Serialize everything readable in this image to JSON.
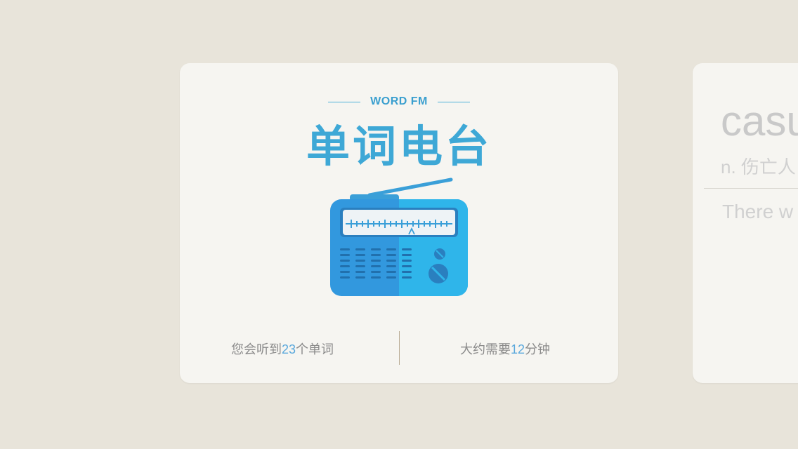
{
  "main_card": {
    "subtitle": "WORD FM",
    "title": "单词电台",
    "stats": {
      "words_prefix": "您会听到",
      "words_count": "23",
      "words_suffix": "个单词",
      "time_prefix": "大约需要",
      "time_count": "12",
      "time_suffix": "分钟"
    }
  },
  "next_card": {
    "word": "casu",
    "pos_meaning": "n. 伤亡人",
    "example": "There w"
  },
  "colors": {
    "accent_blue": "#3ea8d6",
    "radio_body": "#2fb5ea",
    "background": "#e8e4da"
  },
  "icons": {
    "radio": "radio-icon"
  }
}
